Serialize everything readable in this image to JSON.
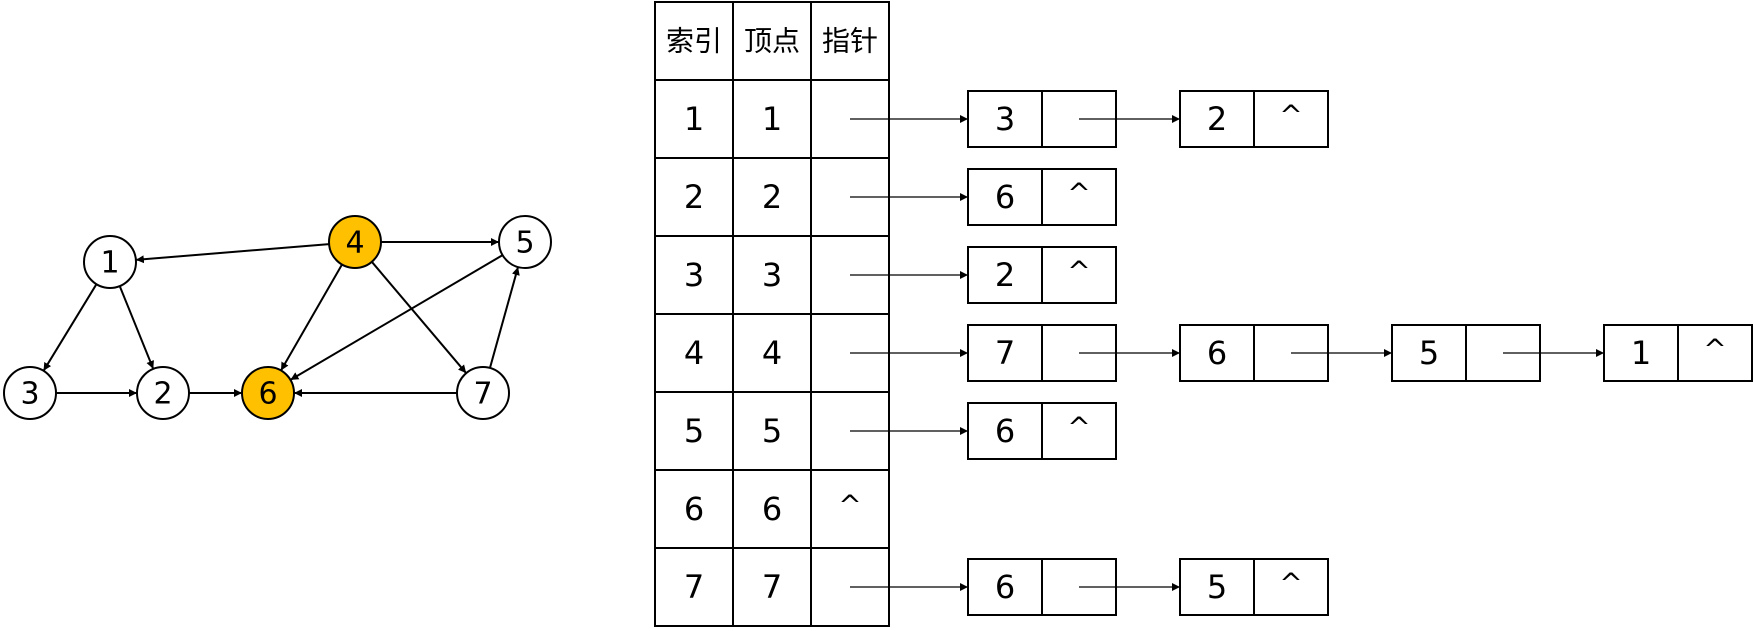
{
  "colors": {
    "highlight": "#FFC000",
    "stroke": "#000000",
    "node_fill": "#FFFFFF"
  },
  "graph": {
    "nodes": [
      {
        "id": "1",
        "label": "1",
        "highlighted": false
      },
      {
        "id": "2",
        "label": "2",
        "highlighted": false
      },
      {
        "id": "3",
        "label": "3",
        "highlighted": false
      },
      {
        "id": "4",
        "label": "4",
        "highlighted": true
      },
      {
        "id": "5",
        "label": "5",
        "highlighted": false
      },
      {
        "id": "6",
        "label": "6",
        "highlighted": true
      },
      {
        "id": "7",
        "label": "7",
        "highlighted": false
      }
    ],
    "edges": [
      {
        "from": "4",
        "to": "1"
      },
      {
        "from": "4",
        "to": "5"
      },
      {
        "from": "4",
        "to": "6"
      },
      {
        "from": "4",
        "to": "7"
      },
      {
        "from": "1",
        "to": "3"
      },
      {
        "from": "1",
        "to": "2"
      },
      {
        "from": "3",
        "to": "2"
      },
      {
        "from": "2",
        "to": "6"
      },
      {
        "from": "7",
        "to": "6"
      },
      {
        "from": "5",
        "to": "6"
      },
      {
        "from": "7",
        "to": "5"
      }
    ]
  },
  "table": {
    "headers": [
      "索引",
      "顶点",
      "指针"
    ],
    "rows": [
      {
        "index": "1",
        "vertex": "1",
        "pointer": "",
        "list": [
          {
            "value": "3",
            "next": ""
          },
          {
            "value": "2",
            "next": "^"
          }
        ]
      },
      {
        "index": "2",
        "vertex": "2",
        "pointer": "",
        "list": [
          {
            "value": "6",
            "next": "^"
          }
        ]
      },
      {
        "index": "3",
        "vertex": "3",
        "pointer": "",
        "list": [
          {
            "value": "2",
            "next": "^"
          }
        ]
      },
      {
        "index": "4",
        "vertex": "4",
        "pointer": "",
        "list": [
          {
            "value": "7",
            "next": ""
          },
          {
            "value": "6",
            "next": ""
          },
          {
            "value": "5",
            "next": ""
          },
          {
            "value": "1",
            "next": "^"
          }
        ]
      },
      {
        "index": "5",
        "vertex": "5",
        "pointer": "",
        "list": [
          {
            "value": "6",
            "next": "^"
          }
        ]
      },
      {
        "index": "6",
        "vertex": "6",
        "pointer": "^",
        "list": []
      },
      {
        "index": "7",
        "vertex": "7",
        "pointer": "",
        "list": [
          {
            "value": "6",
            "next": ""
          },
          {
            "value": "5",
            "next": "^"
          }
        ]
      }
    ]
  }
}
